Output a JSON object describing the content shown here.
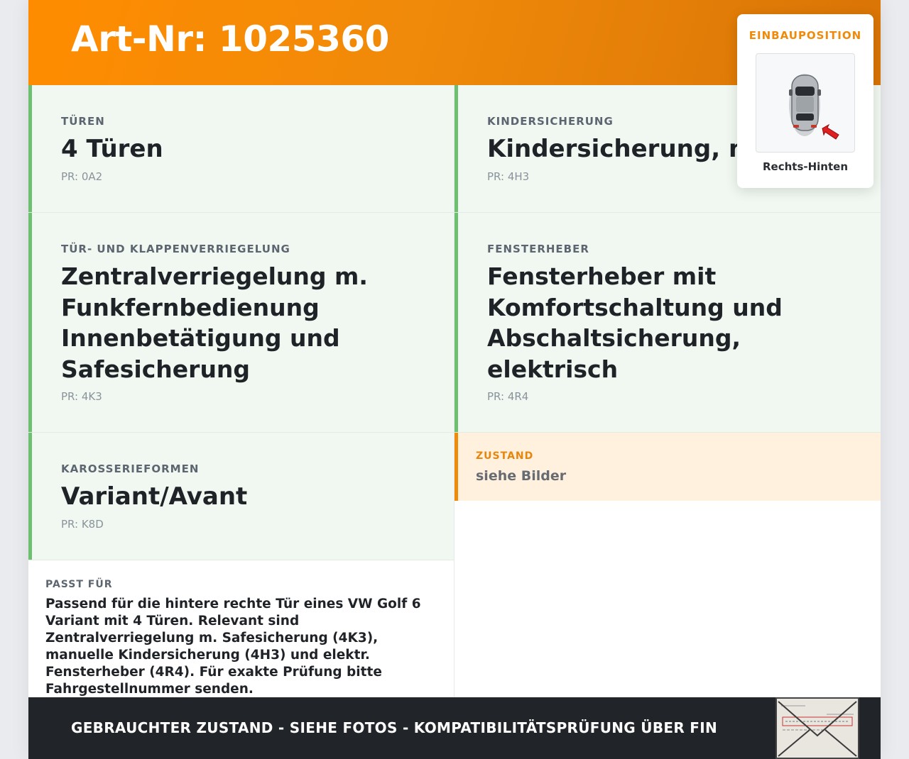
{
  "header": {
    "title": "Art-Nr: 1025360"
  },
  "cells": [
    {
      "label": "TÜREN",
      "value": "4 Türen",
      "pr": "PR: 0A2"
    },
    {
      "label": "KINDERSICHERUNG",
      "value": "Kindersicherung, manuell",
      "pr": "PR: 4H3"
    },
    {
      "label": "TÜR- UND KLAPPENVERRIEGELUNG",
      "value": "Zentralverriegelung m. Funkfernbedienung Innenbetätigung und Safesicherung",
      "pr": "PR: 4K3"
    },
    {
      "label": "FENSTERHEBER",
      "value": "Fensterheber mit Komfortschaltung und Abschaltsicherung, elektrisch",
      "pr": "PR: 4R4"
    },
    {
      "label": "KAROSSERIEFORMEN",
      "value": "Variant/Avant",
      "pr": "PR: K8D"
    }
  ],
  "zustand": {
    "label": "ZUSTAND",
    "value": "siehe Bilder"
  },
  "passt": {
    "label": "PASST FÜR",
    "text": "Passend für die hintere rechte Tür eines VW Golf 6 Variant mit 4 Türen. Relevant sind Zentralverriegelung m. Safesicherung (4K3), manuelle Kindersicherung (4H3) und elektr. Fensterheber (4R4). Für exakte Prüfung bitte Fahrgestellnummer senden."
  },
  "footer": {
    "text": "GEBRAUCHTER ZUSTAND - SIEHE FOTOS - KOMPATIBILITÄTSPRÜFUNG ÜBER FIN"
  },
  "popup": {
    "title": "EINBAUPOSITION",
    "caption": "Rechts-Hinten",
    "icon": "car-top-view-icon"
  },
  "colors": {
    "accent": "#f08a0a",
    "green_border": "#6cc070",
    "cell_bg": "#f1f8f1",
    "footer_bg": "#212429"
  }
}
